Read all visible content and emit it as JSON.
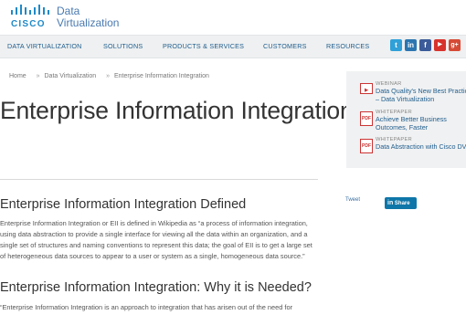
{
  "brand": {
    "logo_text": "CISCO",
    "product_line1": "Data",
    "product_line2": "Virtualization"
  },
  "nav": {
    "items": [
      {
        "label": "DATA VIRTUALIZATION"
      },
      {
        "label": "SOLUTIONS"
      },
      {
        "label": "PRODUCTS & SERVICES"
      },
      {
        "label": "CUSTOMERS"
      },
      {
        "label": "RESOURCES"
      }
    ],
    "social": [
      {
        "name": "twitter-icon",
        "glyph": "t",
        "color": "#2fa0d8"
      },
      {
        "name": "linkedin-icon",
        "glyph": "in",
        "color": "#2b76b0"
      },
      {
        "name": "facebook-icon",
        "glyph": "f",
        "color": "#3b5b99"
      },
      {
        "name": "youtube-icon",
        "glyph": "▶",
        "color": "#d8322d"
      },
      {
        "name": "google-plus-icon",
        "glyph": "g+",
        "color": "#d64a35"
      }
    ]
  },
  "breadcrumb": {
    "items": [
      "Home",
      "Data Virtualization",
      "Enterprise Information Integration"
    ],
    "separator": "»"
  },
  "page": {
    "title": "Enterprise Information Integration"
  },
  "sections": [
    {
      "heading": "Enterprise Information Integration Defined",
      "body": "Enterprise Information Integration or EII is defined in Wikipedia as “a process of information integration, using data abstraction to provide a single interface for viewing all the data within an organization, and a single set of structures and naming conventions to represent this data; the goal of EII is to get a large set of heterogeneous data sources to appear to a user or system as a single, homogeneous data source.”"
    },
    {
      "heading": "Enterprise Information Integration: Why it is Needed?",
      "body": "“Enterprise Information Integration is an approach to integration that has arisen out of the need for"
    }
  ],
  "sidebar": {
    "resources": [
      {
        "type": "WEBINAR",
        "title": "Data Quality's New Best Practice – Data Virtualization",
        "icon": "video-icon"
      },
      {
        "type": "WHITEPAPER",
        "title": "Achieve Better Business Outcomes, Faster",
        "icon": "pdf-icon"
      },
      {
        "type": "WHITEPAPER",
        "title": "Data Abstraction with Cisco DV",
        "icon": "pdf-icon"
      }
    ]
  },
  "social_share": {
    "tweet_label": "Tweet",
    "share_label": "Share",
    "linkedin_glyph": "in"
  }
}
